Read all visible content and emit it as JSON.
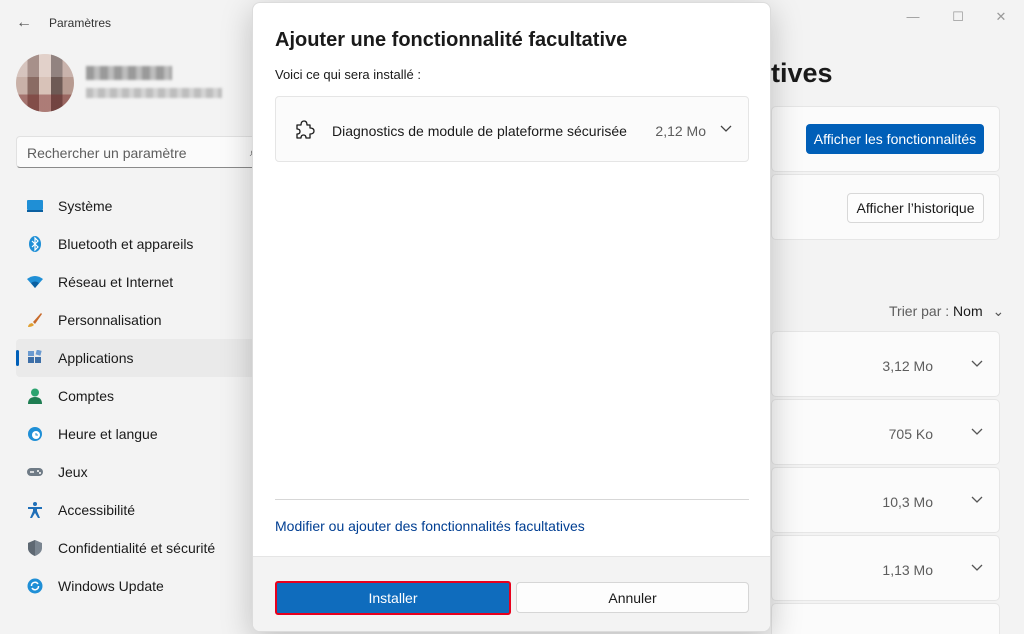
{
  "window": {
    "title": "Paramètres",
    "back_icon": "back-arrow-icon",
    "controls": {
      "minimize": "—",
      "maximize": "☐",
      "close": "✕"
    }
  },
  "search": {
    "placeholder": "Rechercher un paramètre"
  },
  "sidebar": {
    "items": [
      {
        "label": "Système",
        "icon": "system-icon",
        "active": false
      },
      {
        "label": "Bluetooth et appareils",
        "icon": "bluetooth-icon",
        "active": false
      },
      {
        "label": "Réseau et Internet",
        "icon": "wifi-icon",
        "active": false
      },
      {
        "label": "Personnalisation",
        "icon": "brush-icon",
        "active": false
      },
      {
        "label": "Applications",
        "icon": "apps-icon",
        "active": true
      },
      {
        "label": "Comptes",
        "icon": "account-icon",
        "active": false
      },
      {
        "label": "Heure et langue",
        "icon": "clock-globe-icon",
        "active": false
      },
      {
        "label": "Jeux",
        "icon": "gamepad-icon",
        "active": false
      },
      {
        "label": "Accessibilité",
        "icon": "accessibility-icon",
        "active": false
      },
      {
        "label": "Confidentialité et sécurité",
        "icon": "shield-icon",
        "active": false
      },
      {
        "label": "Windows Update",
        "icon": "update-icon",
        "active": false
      }
    ]
  },
  "main": {
    "heading": "tives",
    "view_features_button": "Afficher les fonctionnalités",
    "view_history_button": "Afficher l’historique",
    "sort_label": "Trier par :",
    "sort_value": "Nom",
    "rows": [
      {
        "size": "3,12 Mo"
      },
      {
        "size": "705 Ko"
      },
      {
        "size": "10,3 Mo"
      },
      {
        "size": "1,13 Mo"
      }
    ]
  },
  "dialog": {
    "title": "Ajouter une fonctionnalité facultative",
    "subtitle": "Voici ce qui sera installé :",
    "feature": {
      "name": "Diagnostics de module de plateforme sécurisée",
      "size": "2,12 Mo",
      "icon": "puzzle-piece-icon"
    },
    "link": "Modifier ou ajouter des fonctionnalités facultatives",
    "install_button": "Installer",
    "cancel_button": "Annuler"
  },
  "colors": {
    "accent": "#005fb8",
    "install_button": "#0f6cbd",
    "highlight_border": "#e8001c",
    "link": "#003e92"
  }
}
